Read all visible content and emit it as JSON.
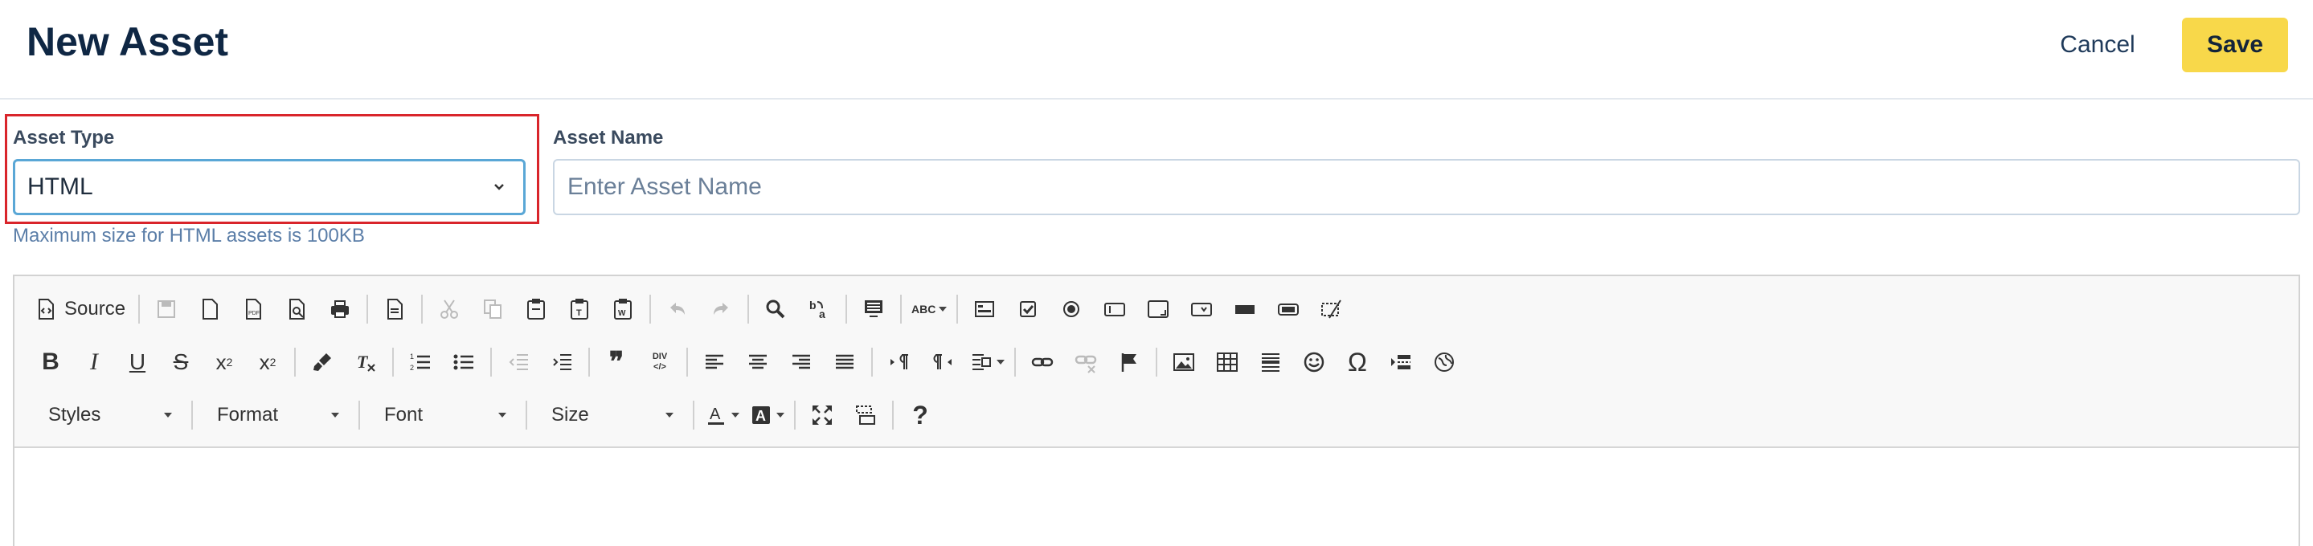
{
  "header": {
    "title": "New Asset",
    "cancel_label": "Cancel",
    "save_label": "Save"
  },
  "form": {
    "asset_type": {
      "label": "Asset Type",
      "value": "HTML",
      "hint": "Maximum size for HTML assets is 100KB"
    },
    "asset_name": {
      "label": "Asset Name",
      "placeholder": "Enter Asset Name",
      "value": ""
    }
  },
  "editor": {
    "source_label": "Source",
    "combos": {
      "styles": "Styles",
      "format": "Format",
      "font": "Font",
      "size": "Size"
    },
    "glyphs": {
      "blockquote": "❞",
      "div": "DIV",
      "special_char": "Ω",
      "help": "?",
      "spell": "ABC"
    }
  },
  "colors": {
    "accent": "#f8d84a",
    "highlight": "#d9252b",
    "focus": "#5aa7d6",
    "title": "#0f2744"
  }
}
